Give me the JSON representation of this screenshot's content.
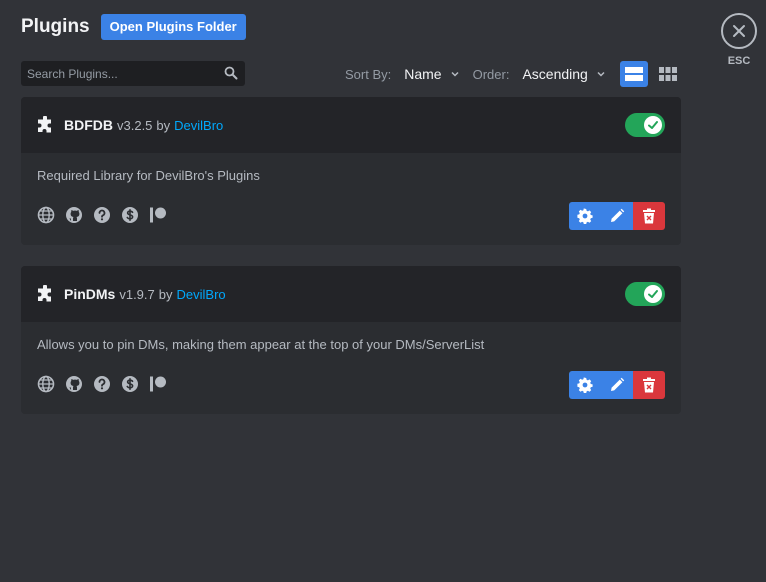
{
  "header": {
    "title": "Plugins",
    "open_folder_label": "Open Plugins Folder",
    "close_label": "ESC"
  },
  "search": {
    "placeholder": "Search Plugins...",
    "value": ""
  },
  "sort": {
    "label": "Sort By:",
    "value": "Name",
    "order_label": "Order:",
    "order_value": "Ascending"
  },
  "view": {
    "selected": "list"
  },
  "plugins": [
    {
      "name": "BDFDB",
      "version": "v3.2.5",
      "by": "by",
      "author": "DevilBro",
      "description": "Required Library for DevilBro's Plugins",
      "enabled": true
    },
    {
      "name": "PinDMs",
      "version": "v1.9.7",
      "by": "by",
      "author": "DevilBro",
      "description": "Allows you to pin DMs, making them appear at the top of your DMs/ServerList",
      "enabled": true
    }
  ],
  "colors": {
    "background": "#313338",
    "card": "#2b2d31",
    "card_header": "#232428",
    "accent": "#3b82e6",
    "toggle_on": "#23a559",
    "danger": "#da373c",
    "link": "#00a8fc"
  },
  "icons": {
    "links": [
      "globe-icon",
      "github-icon",
      "help-icon",
      "donate-icon",
      "patreon-icon"
    ],
    "actions": [
      "gear-icon",
      "pencil-icon",
      "trash-icon"
    ]
  }
}
